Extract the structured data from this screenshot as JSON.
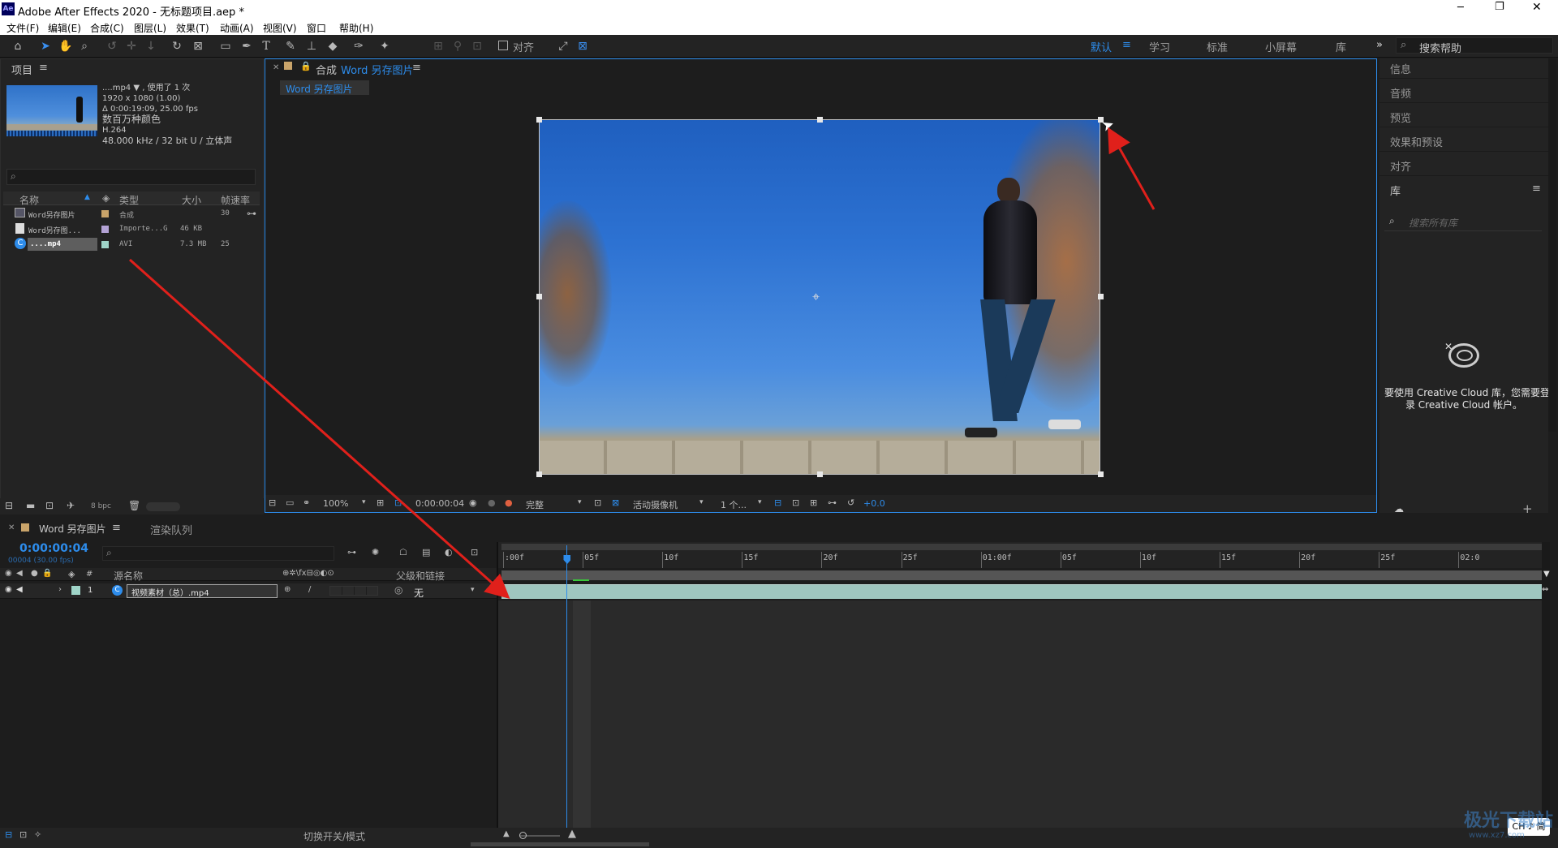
{
  "title": "Adobe After Effects 2020 - 无标题项目.aep *",
  "app_icon": "Ae",
  "window_controls": {
    "min": "─",
    "max": "❐",
    "close": "✕"
  },
  "menu": [
    "文件(F)",
    "编辑(E)",
    "合成(C)",
    "图层(L)",
    "效果(T)",
    "动画(A)",
    "视图(V)",
    "窗口",
    "帮助(H)"
  ],
  "toolbar": {
    "align_label": "对齐",
    "workspaces": [
      "默认",
      "学习",
      "标准",
      "小屏幕",
      "库"
    ],
    "more": "»",
    "search_placeholder": "搜索帮助"
  },
  "project": {
    "tab": "项目",
    "menu_icon": "≡",
    "info": [
      "....mp4 ▼ , 使用了 1 次",
      "1920 x 1080 (1.00)",
      "Δ 0:00:19:09, 25.00 fps",
      "数百万种颜色",
      "H.264",
      "48.000 kHz / 32 bit U / 立体声"
    ],
    "columns": {
      "name": "名称",
      "type": "类型",
      "size": "大小",
      "fps": "帧速率"
    },
    "rows": [
      {
        "name": "Word另存图片",
        "color": "#c9a46a",
        "type": "合成",
        "size": "",
        "fps": "30"
      },
      {
        "name": "Word另存图...",
        "color": "#b4a3d6",
        "type": "Importe...G",
        "size": "46 KB",
        "fps": ""
      },
      {
        "name": "....mp4",
        "color": "#9fd4c8",
        "type": "AVI",
        "size": "7.3 MB",
        "fps": "25"
      }
    ],
    "bpc": "8 bpc"
  },
  "composition": {
    "tab_prefix": "合成",
    "tab_name": "Word 另存图片",
    "menu_icon": "≡",
    "subtab": "Word 另存图片",
    "zoom": "100%",
    "timecode": "0:00:00:04",
    "resolution": "完整",
    "camera": "活动摄像机",
    "views": "1 个...",
    "exposure": "+0.0"
  },
  "right_panel": {
    "items": [
      "信息",
      "音频",
      "预览",
      "效果和预设",
      "对齐"
    ],
    "library_tab": "库",
    "library_menu": "≡",
    "search_placeholder": "搜索所有库",
    "cc_line1": "要使用 Creative Cloud 库，您需要登",
    "cc_line2": "录 Creative Cloud 帐户。",
    "add": "+"
  },
  "timeline": {
    "tab_name": "Word 另存图片",
    "menu_icon": "≡",
    "render_tab": "渲染队列",
    "current_time": "0:00:00:04",
    "frame_info": "00004 (30.00 fps)",
    "col_source": "源名称",
    "col_parent": "父级和链接",
    "layer_num": "1",
    "layer_name": "视频素材（总）.mp4",
    "parent_value": "无",
    "ruler": [
      ":00f",
      "05f",
      "10f",
      "15f",
      "20f",
      "25f",
      "01:00f",
      "05f",
      "10f",
      "15f",
      "20f",
      "25f",
      "02:0"
    ],
    "playhead_frame": 4,
    "ruler_max_frames": 62,
    "footer_toggle": "切换开关/模式"
  },
  "ime": "CH ♪ 简",
  "watermark_line1": "极光下载站",
  "watermark_line2": "www.xz7.com",
  "colors": {
    "accent": "#2d8ceb",
    "annotation_arrow": "#e0201b",
    "layer_bar": "#9fc6bf",
    "sky": "#3578d0"
  },
  "icons": [
    "home-icon",
    "selection-icon",
    "hand-icon",
    "zoom-icon",
    "rotate-icon",
    "pen-icon",
    "type-icon",
    "brush-icon",
    "stamp-icon",
    "eraser-icon",
    "puppet-icon",
    "search-icon",
    "anchor-icon",
    "lock-icon",
    "eye-icon",
    "speaker-icon",
    "creative-cloud-icon"
  ]
}
